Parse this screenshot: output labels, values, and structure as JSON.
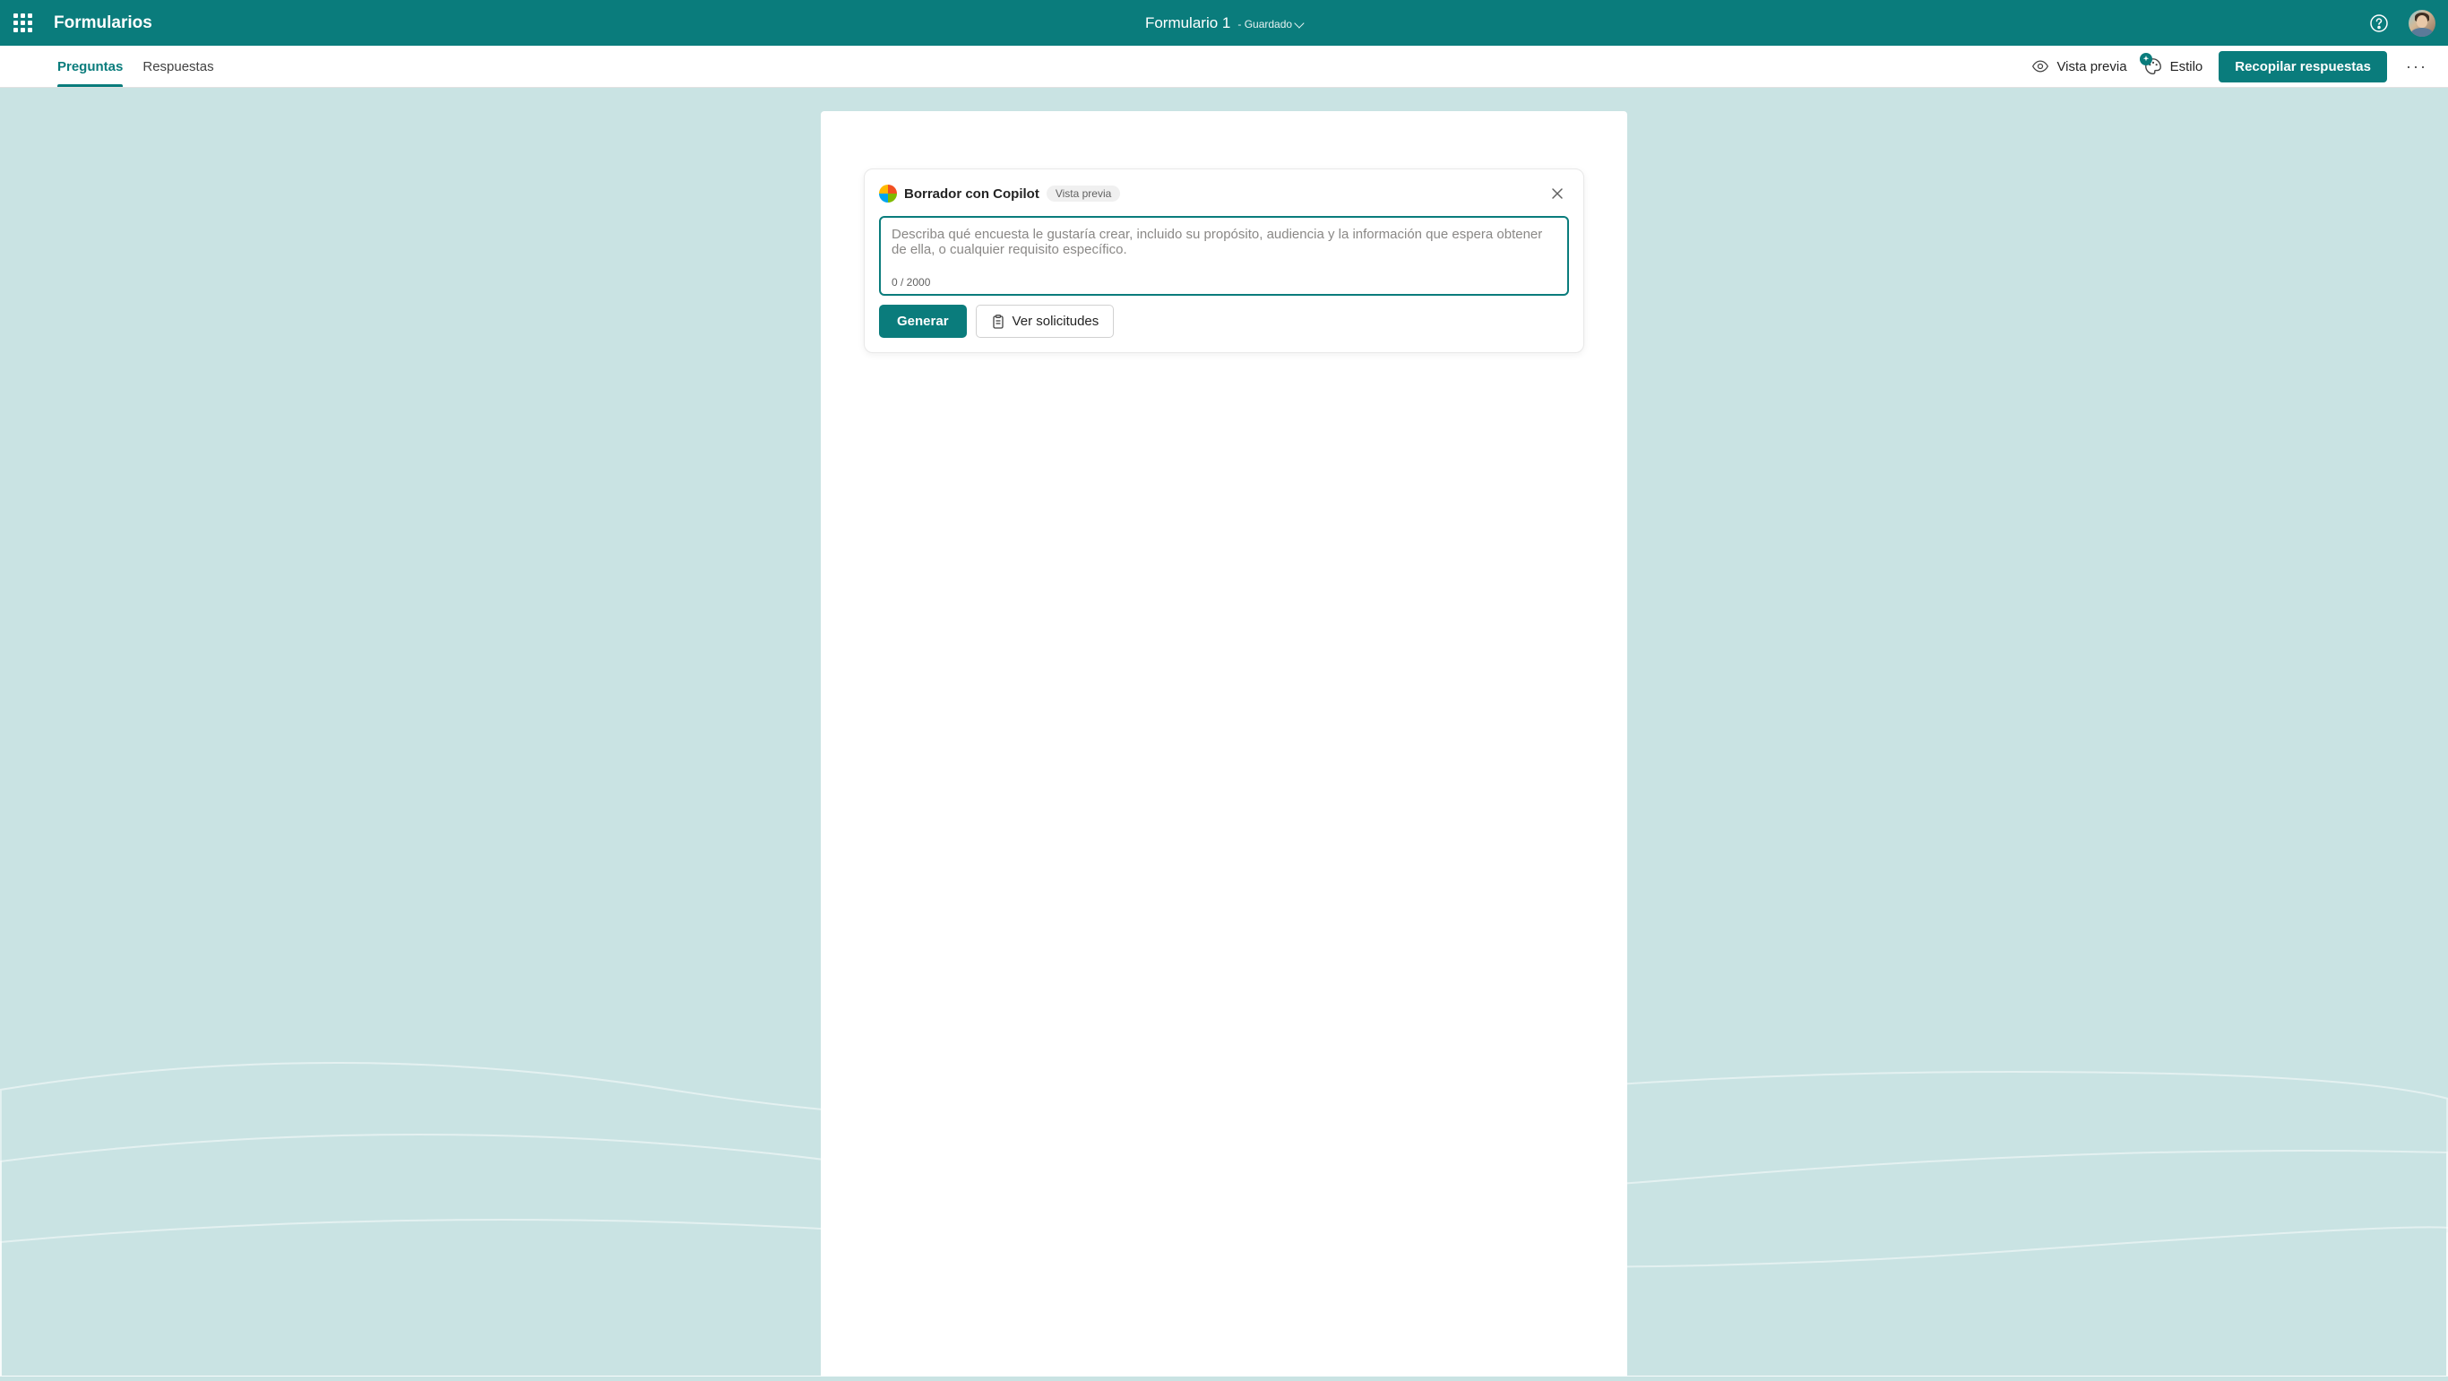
{
  "header": {
    "app_name": "Formularios",
    "form_title": "Formulario 1",
    "saved_status": "- Guardado"
  },
  "toolbar": {
    "tabs": {
      "questions": "Preguntas",
      "responses": "Respuestas"
    },
    "preview": "Vista previa",
    "style": "Estilo",
    "collect": "Recopilar respuestas"
  },
  "copilot": {
    "title": "Borrador con Copilot",
    "badge": "Vista previa",
    "placeholder": "Describa qué encuesta le gustaría crear, incluido su propósito, audiencia y la información que espera obtener de ella, o cualquier requisito específico.",
    "char_count": "0 / 2000",
    "generate": "Generar",
    "view_prompts": "Ver solicitudes"
  }
}
